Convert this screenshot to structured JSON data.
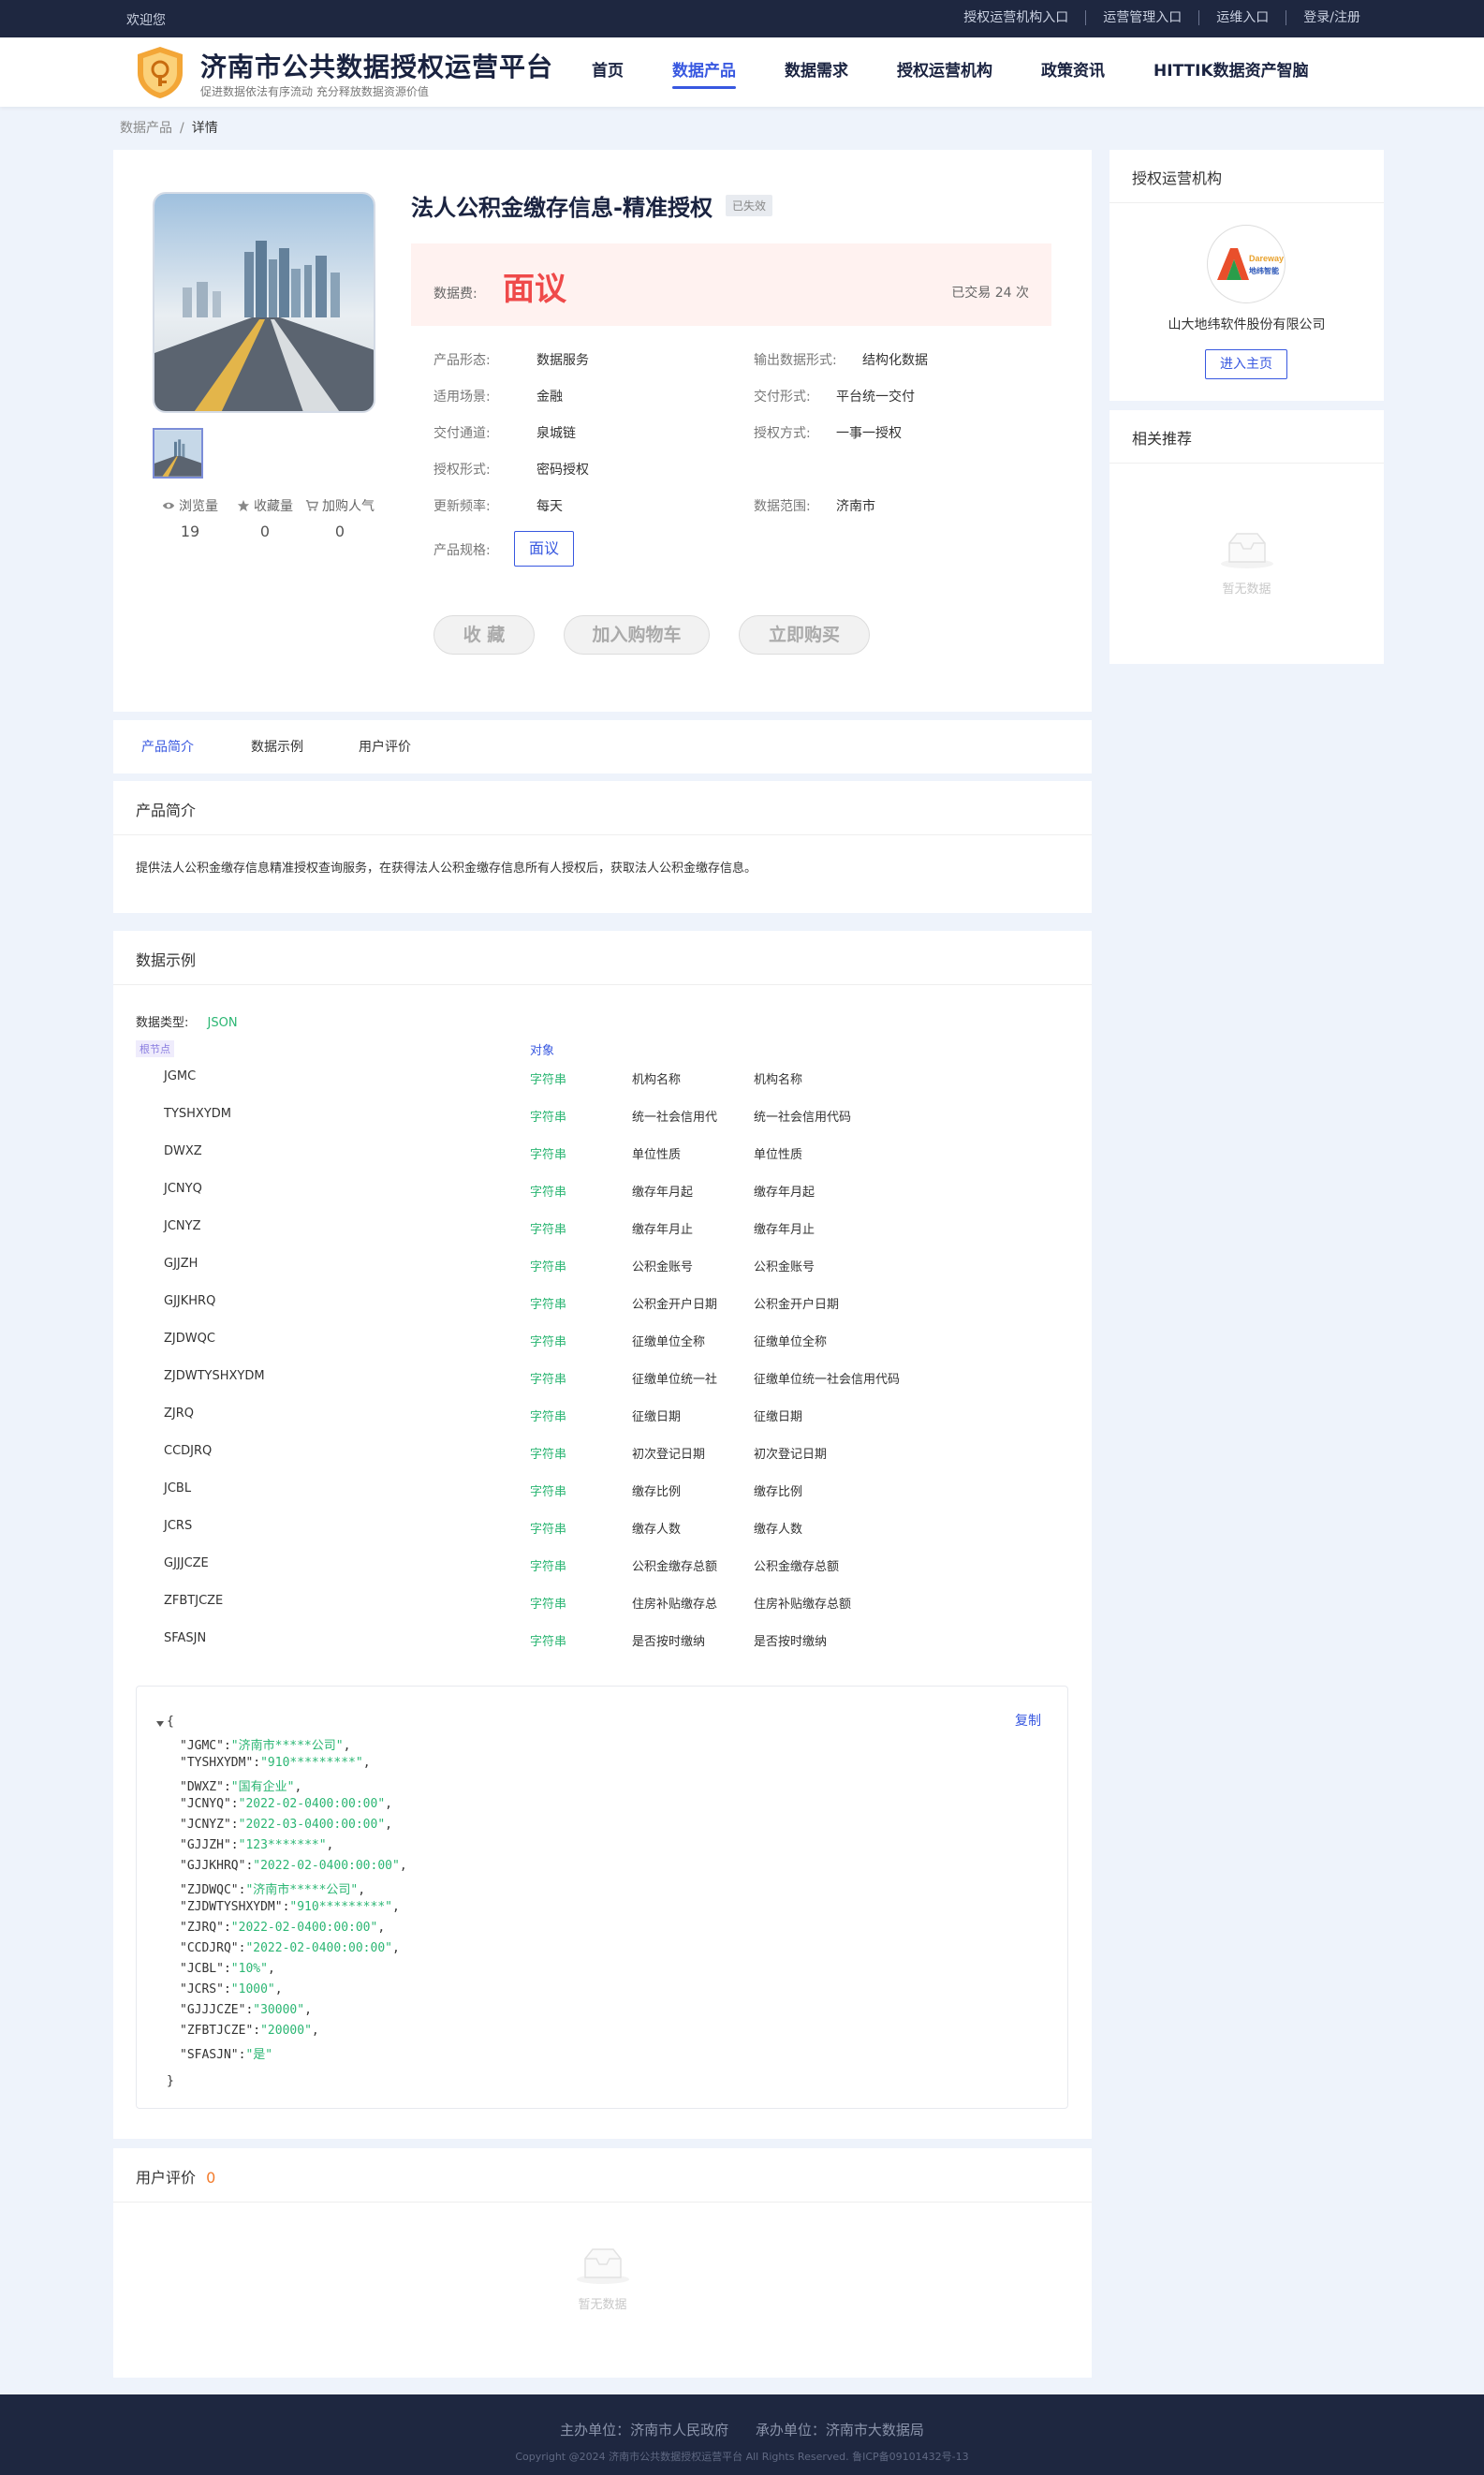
{
  "topbar": {
    "welcome": "欢迎您",
    "links": [
      "授权运营机构入口",
      "运营管理入口",
      "运维入口",
      "登录/注册"
    ]
  },
  "header": {
    "title": "济南市公共数据授权运营平台",
    "subtitle": "促进数据依法有序流动 充分释放数据资源价值",
    "nav": [
      "首页",
      "数据产品",
      "数据需求",
      "授权运营机构",
      "政策资讯",
      "HITTIK数据资产智脑"
    ],
    "active_nav": "数据产品"
  },
  "breadcrumb": {
    "parent": "数据产品",
    "sep": "/",
    "current": "详情"
  },
  "product": {
    "title": "法人公积金缴存信息-精准授权",
    "status": "已失效",
    "price_label": "数据费:",
    "price": "面议",
    "traded": "已交易 24 次",
    "stats": [
      {
        "label": "浏览量",
        "value": "19",
        "icon": "eye-icon"
      },
      {
        "label": "收藏量",
        "value": "0",
        "icon": "star-icon"
      },
      {
        "label": "加购人气",
        "value": "0",
        "icon": "cart-icon"
      }
    ],
    "attrs": {
      "form_k": "产品形态:",
      "form_v": "数据服务",
      "output_k": "输出数据形式:",
      "output_v": "结构化数据",
      "scene_k": "适用场景:",
      "scene_v": "金融",
      "deliver_form_k": "交付形式:",
      "deliver_form_v": "平台统一交付",
      "channel_k": "交付通道:",
      "channel_v": "泉城链",
      "auth_mode_k": "授权方式:",
      "auth_mode_v": "一事一授权",
      "auth_form_k": "授权形式:",
      "auth_form_v": "密码授权",
      "freq_k": "更新频率:",
      "freq_v": "每天",
      "range_k": "数据范围:",
      "range_v": "济南市",
      "spec_k": "产品规格:",
      "spec_v": "面议"
    },
    "buttons": {
      "favorite": "收 藏",
      "cart": "加入购物车",
      "buy": "立即购买"
    }
  },
  "side": {
    "org_title": "授权运营机构",
    "org_name": "山大地纬软件股份有限公司",
    "org_logo_text": "Dareway",
    "org_logo_cn": "地纬智能",
    "enter": "进入主页",
    "rec_title": "相关推荐",
    "empty": "暂无数据"
  },
  "tabs": [
    "产品简介",
    "数据示例",
    "用户评价"
  ],
  "intro": {
    "title": "产品简介",
    "text": "提供法人公积金缴存信息精准授权查询服务，在获得法人公积金缴存信息所有人授权后，获取法人公积金缴存信息。"
  },
  "example": {
    "title": "数据示例",
    "type_label": "数据类型:",
    "type_value": "JSON",
    "root_tag": "根节点",
    "root_type": "对象",
    "fields": [
      {
        "code": "JGMC",
        "type": "字符串",
        "name": "机构名称",
        "desc": "机构名称"
      },
      {
        "code": "TYSHXYDM",
        "type": "字符串",
        "name": "统一社会信用代",
        "desc": "统一社会信用代码"
      },
      {
        "code": "DWXZ",
        "type": "字符串",
        "name": "单位性质",
        "desc": "单位性质"
      },
      {
        "code": "JCNYQ",
        "type": "字符串",
        "name": "缴存年月起",
        "desc": "缴存年月起"
      },
      {
        "code": "JCNYZ",
        "type": "字符串",
        "name": "缴存年月止",
        "desc": "缴存年月止"
      },
      {
        "code": "GJJZH",
        "type": "字符串",
        "name": "公积金账号",
        "desc": "公积金账号"
      },
      {
        "code": "GJJKHRQ",
        "type": "字符串",
        "name": "公积金开户日期",
        "desc": "公积金开户日期"
      },
      {
        "code": "ZJDWQC",
        "type": "字符串",
        "name": "征缴单位全称",
        "desc": "征缴单位全称"
      },
      {
        "code": "ZJDWTYSHXYDM",
        "type": "字符串",
        "name": "征缴单位统一社",
        "desc": "征缴单位统一社会信用代码"
      },
      {
        "code": "ZJRQ",
        "type": "字符串",
        "name": "征缴日期",
        "desc": "征缴日期"
      },
      {
        "code": "CCDJRQ",
        "type": "字符串",
        "name": "初次登记日期",
        "desc": "初次登记日期"
      },
      {
        "code": "JCBL",
        "type": "字符串",
        "name": "缴存比例",
        "desc": "缴存比例"
      },
      {
        "code": "JCRS",
        "type": "字符串",
        "name": "缴存人数",
        "desc": "缴存人数"
      },
      {
        "code": "GJJJCZE",
        "type": "字符串",
        "name": "公积金缴存总额",
        "desc": "公积金缴存总额"
      },
      {
        "code": "ZFBTJCZE",
        "type": "字符串",
        "name": "住房补贴缴存总",
        "desc": "住房补贴缴存总额"
      },
      {
        "code": "SFASJN",
        "type": "字符串",
        "name": "是否按时缴纳",
        "desc": "是否按时缴纳"
      }
    ],
    "copy": "复制",
    "json_open": "{",
    "json_close": "}",
    "json_lines": [
      {
        "key": "\"JGMC\"",
        "val": "\"济南市*****公司\""
      },
      {
        "key": "\"TYSHXYDM\"",
        "val": "\"910*********\""
      },
      {
        "key": "\"DWXZ\"",
        "val": "\"国有企业\""
      },
      {
        "key": "\"JCNYQ\"",
        "val": "\"2022-02-0400:00:00\""
      },
      {
        "key": "\"JCNYZ\"",
        "val": "\"2022-03-0400:00:00\""
      },
      {
        "key": "\"GJJZH\"",
        "val": "\"123*******\""
      },
      {
        "key": "\"GJJKHRQ\"",
        "val": "\"2022-02-0400:00:00\""
      },
      {
        "key": "\"ZJDWQC\"",
        "val": "\"济南市*****公司\""
      },
      {
        "key": "\"ZJDWTYSHXYDM\"",
        "val": "\"910*********\""
      },
      {
        "key": "\"ZJRQ\"",
        "val": "\"2022-02-0400:00:00\""
      },
      {
        "key": "\"CCDJRQ\"",
        "val": "\"2022-02-0400:00:00\""
      },
      {
        "key": "\"JCBL\"",
        "val": "\"10%\""
      },
      {
        "key": "\"JCRS\"",
        "val": "\"1000\""
      },
      {
        "key": "\"GJJJCZE\"",
        "val": "\"30000\""
      },
      {
        "key": "\"ZFBTJCZE\"",
        "val": "\"20000\""
      },
      {
        "key": "\"SFASJN\"",
        "val": "\"是\""
      }
    ]
  },
  "review": {
    "title": "用户评价",
    "count": "0",
    "empty": "暂无数据"
  },
  "footer": {
    "host": "主办单位：济南市人民政府",
    "organizer": "承办单位：济南市大数据局",
    "copyright": "Copyright @2024 济南市公共数据授权运营平台 All Rights Reserved. 鲁ICP备09101432号-13"
  },
  "colors": {
    "accent": "#3858e0",
    "price": "#ef4a4a",
    "string_type": "#2bb673",
    "dark": "#1e2740"
  }
}
